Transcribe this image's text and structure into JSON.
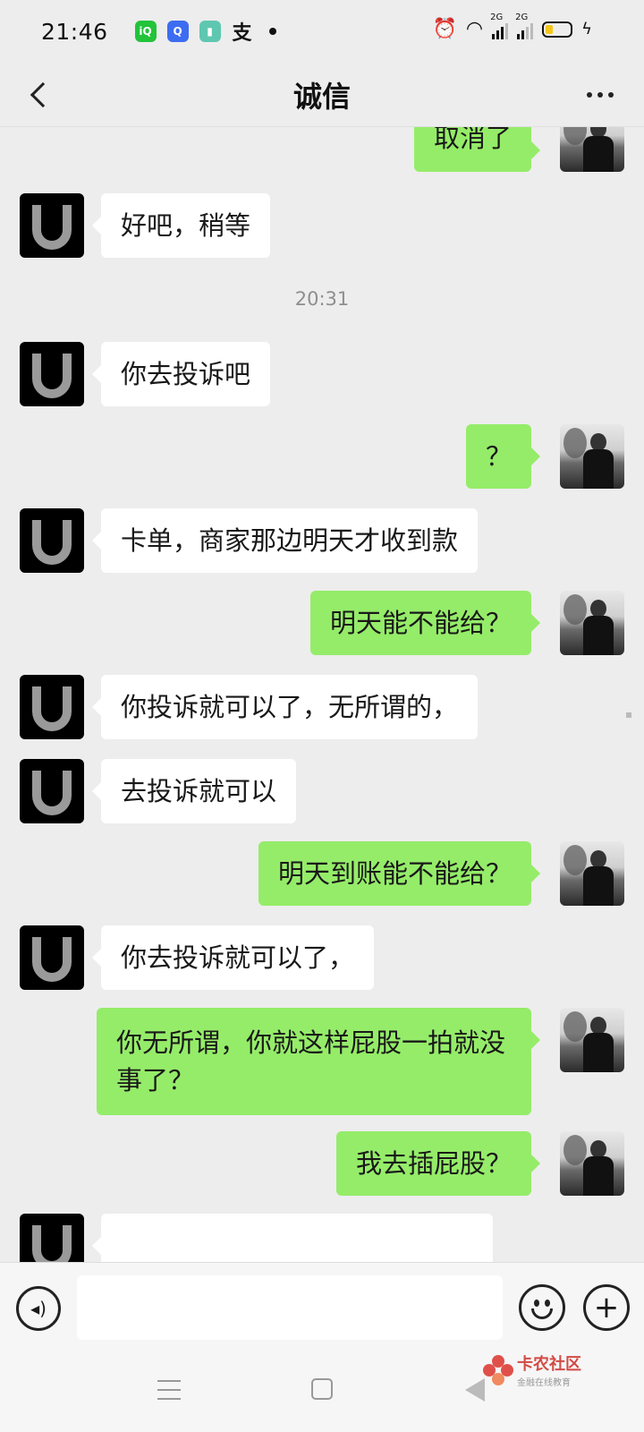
{
  "status_bar": {
    "time": "21:46",
    "network_1": "2G",
    "network_2": "2G"
  },
  "header": {
    "title": "诚信"
  },
  "messages": [
    {
      "side": "right",
      "text": "取消了"
    },
    {
      "side": "left",
      "text": "好吧，稍等"
    },
    {
      "type": "time",
      "text": "20:31"
    },
    {
      "side": "left",
      "text": "你去投诉吧"
    },
    {
      "side": "right",
      "text": "？"
    },
    {
      "side": "left",
      "text": "卡单，商家那边明天才收到款"
    },
    {
      "side": "right",
      "text": "明天能不能给？"
    },
    {
      "side": "left",
      "text": "你投诉就可以了，无所谓的，"
    },
    {
      "side": "left",
      "text": "去投诉就可以"
    },
    {
      "side": "right",
      "text": "明天到账能不能给？"
    },
    {
      "side": "left",
      "text": "你去投诉就可以了，"
    },
    {
      "side": "right",
      "text": "你无所谓，你就这样屁股一拍就没事了？"
    },
    {
      "side": "right",
      "text": "我去插屁股？"
    }
  ],
  "input_bar": {
    "voice_icon": "voice-icon",
    "emoji_icon": "emoji-icon",
    "plus_icon": "plus-icon",
    "placeholder": ""
  },
  "watermark": {
    "title": "卡农社区",
    "subtitle": "金融在线教育"
  },
  "colors": {
    "bubble_sent": "#95ec69",
    "bubble_received": "#ffffff",
    "background": "#ededed"
  }
}
